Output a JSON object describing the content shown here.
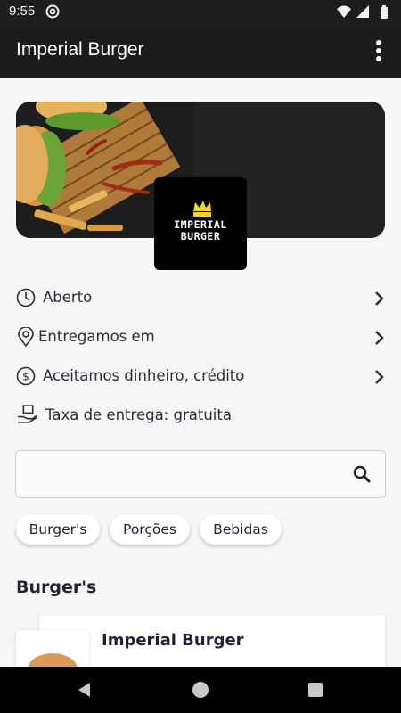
{
  "status_bar": {
    "time": "9:55"
  },
  "app_bar": {
    "title": "Imperial Burger"
  },
  "store": {
    "logo_line1": "IMPERIAL",
    "logo_line2": "BURGER"
  },
  "info": [
    {
      "icon": "clock-icon",
      "label": "Aberto"
    },
    {
      "icon": "location-pin-icon",
      "label": "Entregamos em"
    },
    {
      "icon": "dollar-icon",
      "label": "Aceitamos dinheiro, crédito"
    },
    {
      "icon": "delivery-hand-icon",
      "label": "Taxa de entrega: gratuita"
    }
  ],
  "search": {
    "placeholder": "",
    "value": ""
  },
  "categories": [
    "Burger's",
    "Porções",
    "Bebidas"
  ],
  "section": {
    "title": "Burger's"
  },
  "products": [
    {
      "name": "Imperial Burger"
    }
  ],
  "colors": {
    "app_bar": "#1c1c1c",
    "text_dark": "#1e2436",
    "background": "#f7f7f8"
  }
}
